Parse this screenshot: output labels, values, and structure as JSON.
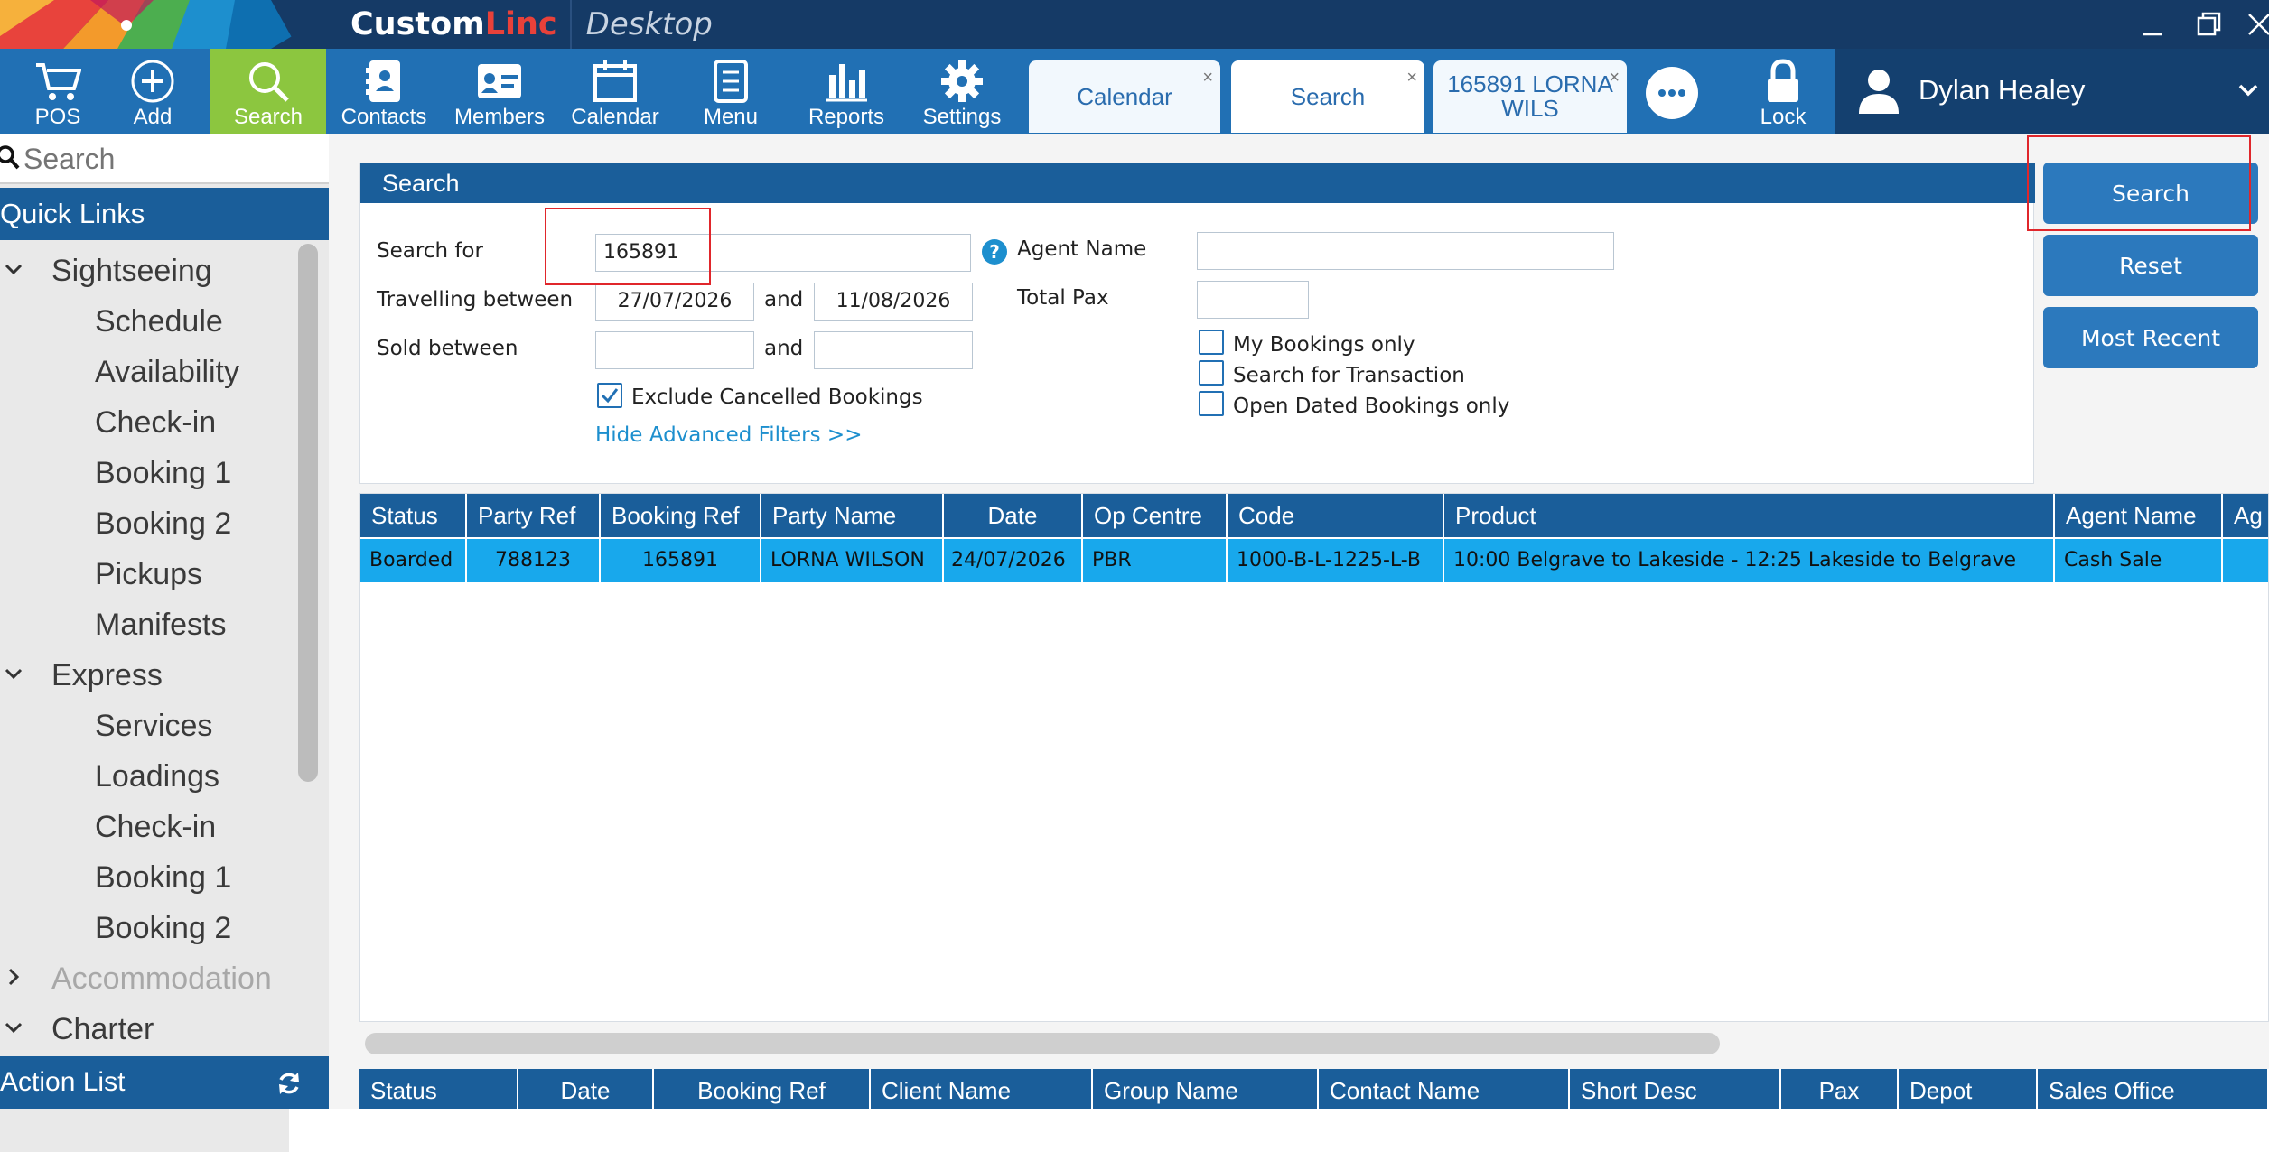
{
  "app": {
    "brand_custom": "Custom",
    "brand_linc": "Linc",
    "brand_product": "Desktop"
  },
  "toolbar": {
    "items": [
      {
        "label": "POS",
        "icon": "cart-icon"
      },
      {
        "label": "Add",
        "icon": "plus-circle-icon"
      },
      {
        "label": "Search",
        "icon": "magnifier-icon",
        "active": true
      },
      {
        "label": "Contacts",
        "icon": "contacts-icon"
      },
      {
        "label": "Members",
        "icon": "member-card-icon"
      },
      {
        "label": "Calendar",
        "icon": "calendar-icon"
      },
      {
        "label": "Menu",
        "icon": "menu-doc-icon"
      },
      {
        "label": "Reports",
        "icon": "bar-chart-icon"
      },
      {
        "label": "Settings",
        "icon": "gear-icon"
      }
    ],
    "tabs": [
      {
        "label": "Calendar",
        "close": "×"
      },
      {
        "label": "Search",
        "close": "×"
      },
      {
        "label": "165891 LORNA WILS",
        "close": "×"
      }
    ],
    "lock_label": "Lock",
    "user_name": "Dylan Healey"
  },
  "sidebar": {
    "search_placeholder": "Search",
    "quick_links_title": "Quick Links",
    "groups": [
      {
        "label": "Sightseeing",
        "expanded": true,
        "items": [
          "Schedule",
          "Availability",
          "Check-in",
          "Booking 1",
          "Booking 2",
          "Pickups",
          "Manifests"
        ]
      },
      {
        "label": "Express",
        "expanded": true,
        "items": [
          "Services",
          "Loadings",
          "Check-in",
          "Booking 1",
          "Booking 2"
        ]
      },
      {
        "label": "Accommodation",
        "expanded": false,
        "disabled": true,
        "items": []
      },
      {
        "label": "Charter",
        "expanded": true,
        "items": []
      }
    ],
    "action_list_title": "Action List"
  },
  "search_form": {
    "title": "Search",
    "search_for_label": "Search for",
    "search_for_value": "165891",
    "help_glyph": "?",
    "travelling_between_label": "Travelling between",
    "travel_from": "27/07/2026",
    "and_label": "and",
    "travel_to": "11/08/2026",
    "sold_between_label": "Sold between",
    "sold_from": "",
    "sold_to": "",
    "exclude_cancelled_label": "Exclude Cancelled Bookings",
    "exclude_cancelled_checked": true,
    "hide_filters_link": "Hide Advanced Filters >>",
    "agent_name_label": "Agent Name",
    "agent_name_value": "",
    "total_pax_label": "Total Pax",
    "total_pax_value": "",
    "my_bookings_label": "My Bookings only",
    "search_transaction_label": "Search for Transaction",
    "open_dated_label": "Open Dated Bookings only"
  },
  "actions": {
    "search_label": "Search",
    "reset_label": "Reset",
    "most_recent_label": "Most Recent"
  },
  "results": {
    "columns": [
      "Status",
      "Party Ref",
      "Booking Ref",
      "Party Name",
      "Date",
      "Op Centre",
      "Code",
      "Product",
      "Agent Name",
      "Ag"
    ],
    "rows": [
      {
        "status": "Boarded",
        "party_ref": "788123",
        "booking_ref": "165891",
        "party_name": "LORNA WILSON",
        "date": "24/07/2026",
        "op_centre": "PBR",
        "code": "1000-B-L-1225-L-B",
        "product": "10:00 Belgrave to Lakeside - 12:25 Lakeside to Belgrave",
        "agent_name": "Cash Sale",
        "ag": ""
      }
    ]
  },
  "actions_grid": {
    "columns": [
      "Status",
      "Date",
      "Booking Ref",
      "Client Name",
      "Group Name",
      "Contact Name",
      "Short Desc",
      "Pax",
      "Depot",
      "Sales Office"
    ]
  },
  "colors": {
    "title_bar": "#153a66",
    "toolbar": "#2170b4",
    "active_tool": "#8cc63f",
    "grid_header": "#1a5e9a",
    "selected_row": "#18a8ec",
    "highlight_box": "#e0262b"
  }
}
